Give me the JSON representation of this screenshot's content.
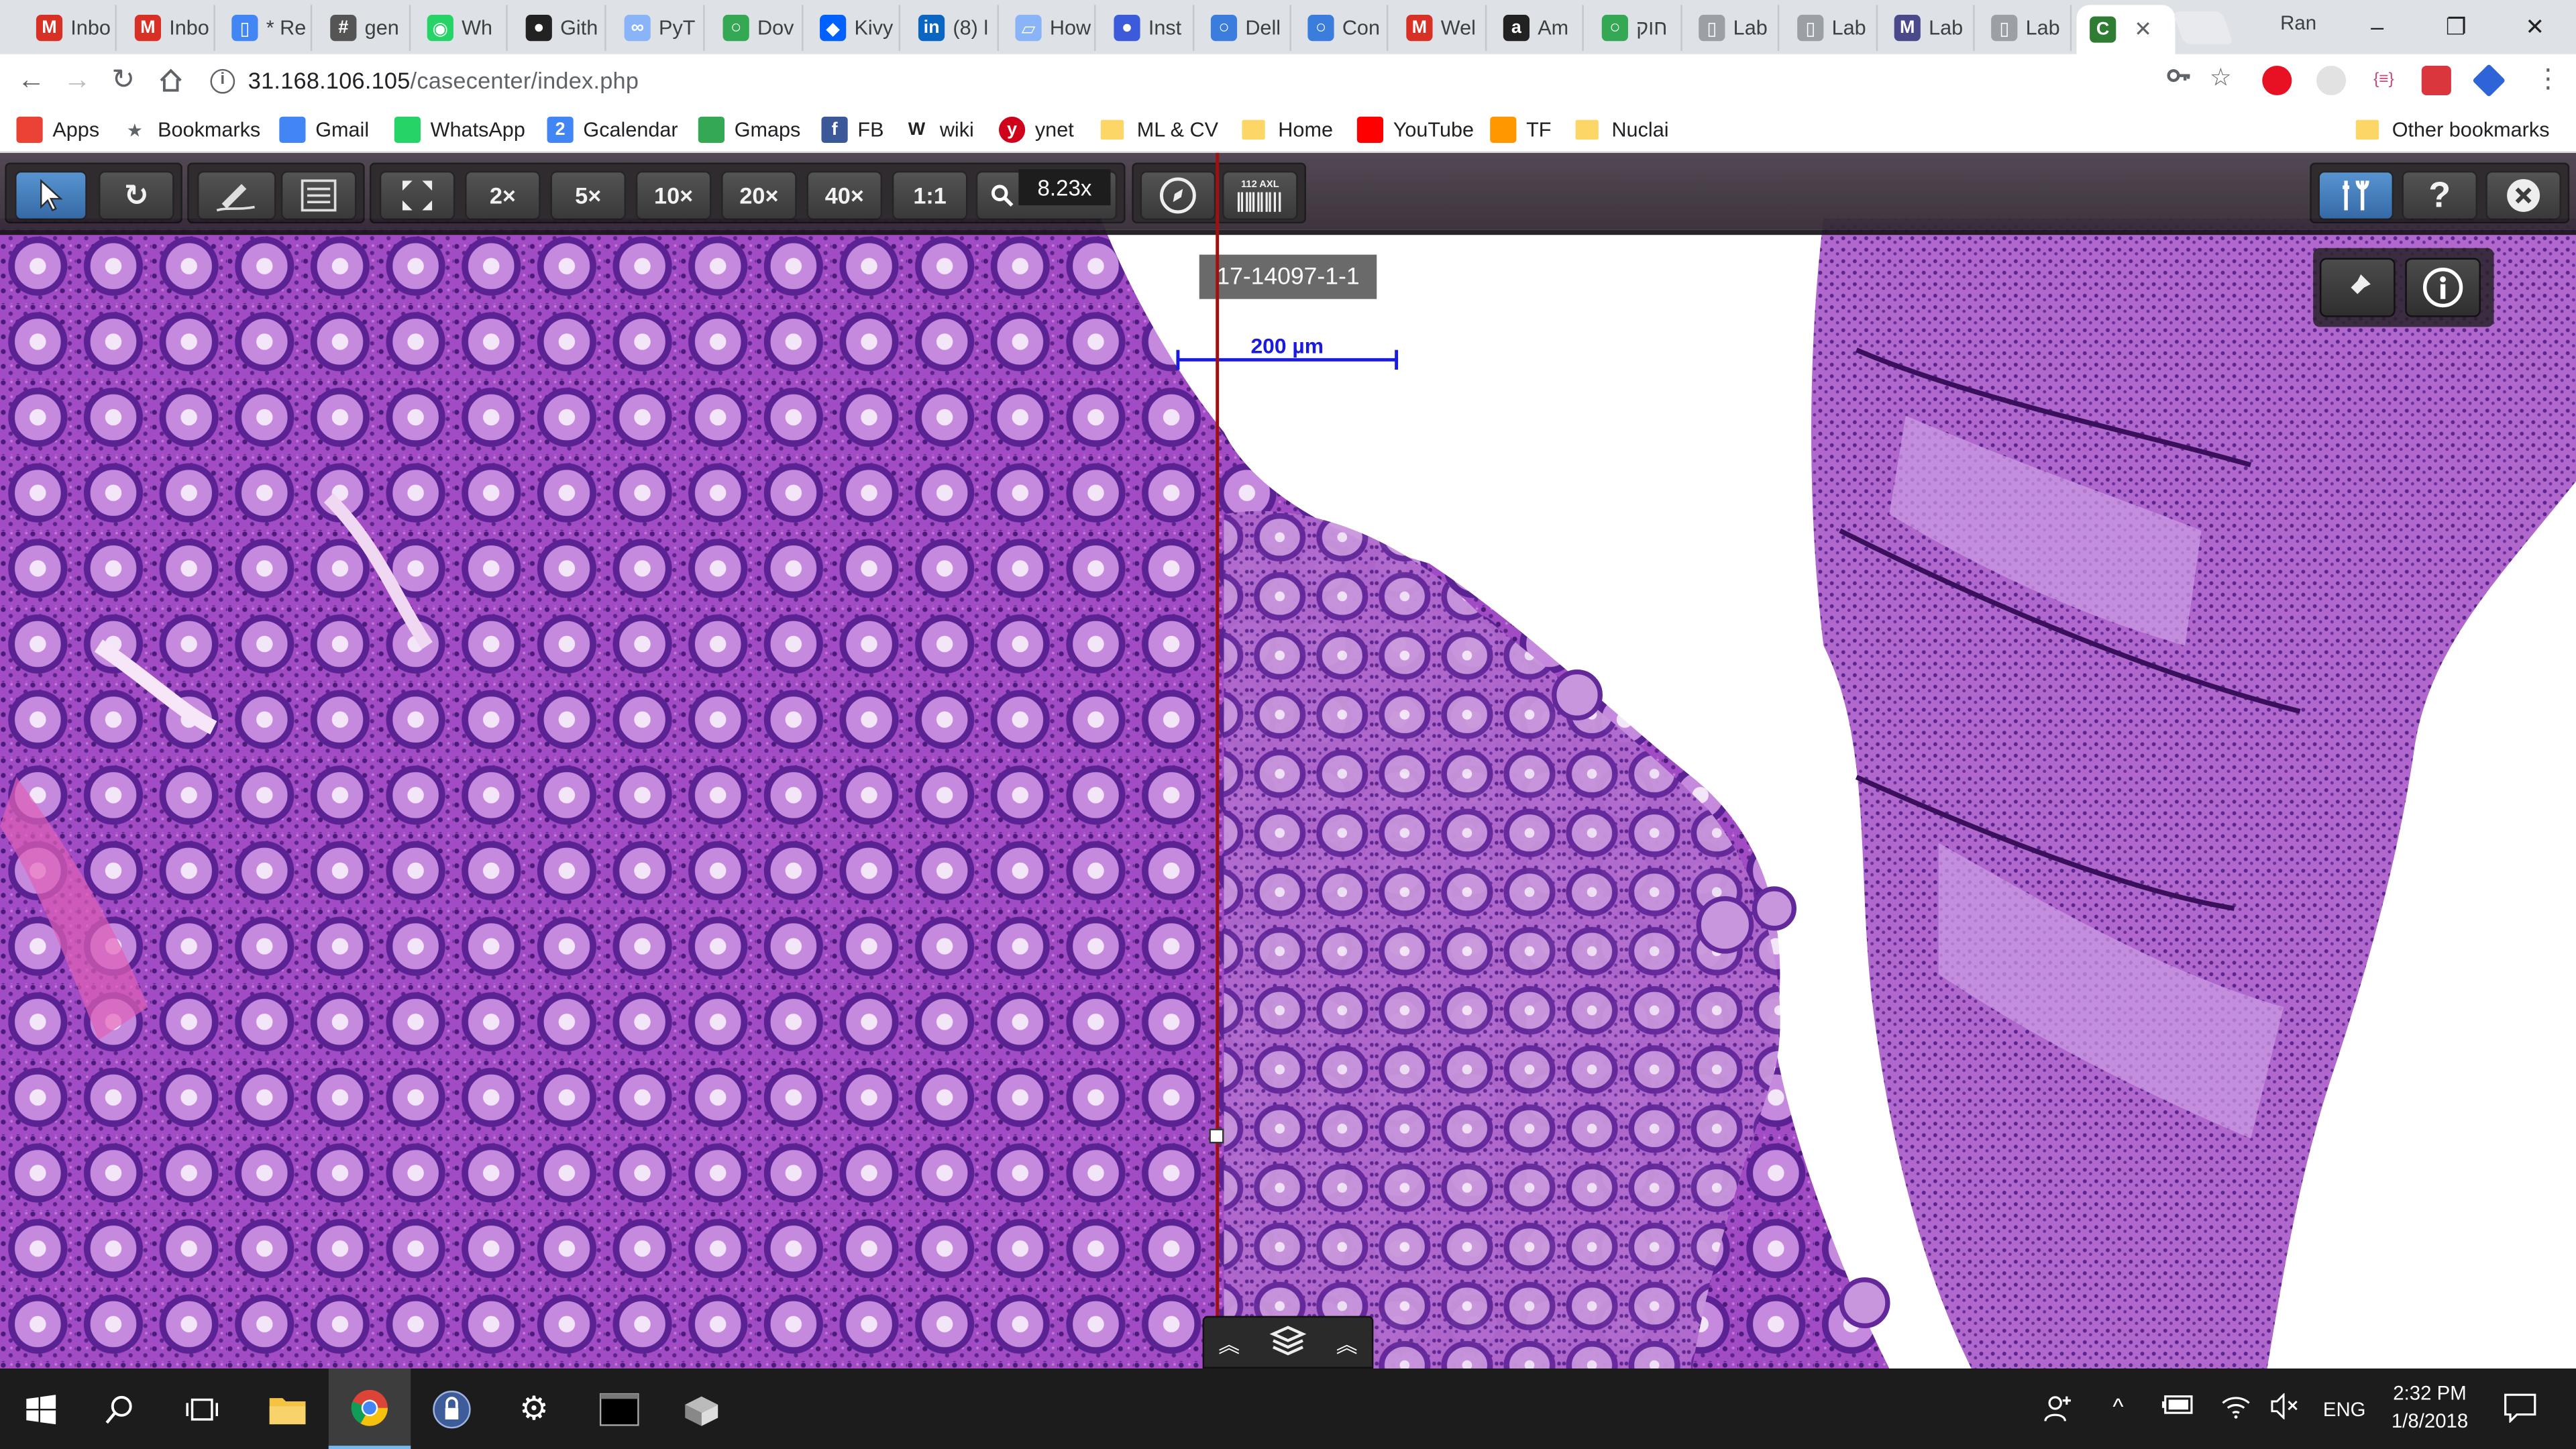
{
  "tabs": [
    {
      "label": "Inbo",
      "icon": "gmail-icon",
      "color": "#d93025",
      "glyph": "M"
    },
    {
      "label": "Inbo",
      "icon": "gmail-icon",
      "color": "#d93025",
      "glyph": "M"
    },
    {
      "label": "* Re",
      "icon": "document-icon",
      "color": "#4285f4",
      "glyph": "▯"
    },
    {
      "label": "gen",
      "icon": "hashtag-icon",
      "color": "#555555",
      "glyph": "#"
    },
    {
      "label": "Wh",
      "icon": "whatsapp-icon",
      "color": "#25d366",
      "glyph": "◉"
    },
    {
      "label": "Gith",
      "icon": "github-icon",
      "color": "#222222",
      "glyph": "●"
    },
    {
      "label": "PyT",
      "icon": "pytorch-icon",
      "color": "#8ab4f8",
      "glyph": "∞"
    },
    {
      "label": "Dov",
      "icon": "circle-icon",
      "color": "#34a853",
      "glyph": "○"
    },
    {
      "label": "Kivy",
      "icon": "dropbox-icon",
      "color": "#0061ff",
      "glyph": "◆"
    },
    {
      "label": "(8) l",
      "icon": "linkedin-icon",
      "color": "#0a66c2",
      "glyph": "in"
    },
    {
      "label": "How",
      "icon": "image-icon",
      "color": "#8ab4f8",
      "glyph": "▱"
    },
    {
      "label": "Inst",
      "icon": "dot-icon",
      "color": "#3b5bdb",
      "glyph": "●"
    },
    {
      "label": "Dell",
      "icon": "dell-icon",
      "color": "#3b7ddd",
      "glyph": "○"
    },
    {
      "label": "Con",
      "icon": "dell-icon",
      "color": "#3b7ddd",
      "glyph": "○"
    },
    {
      "label": "Wel",
      "icon": "gmail-icon",
      "color": "#d93025",
      "glyph": "M"
    },
    {
      "label": "Am",
      "icon": "amazon-icon",
      "color": "#222222",
      "glyph": "a"
    },
    {
      "label": "חוק",
      "icon": "circle-icon",
      "color": "#34a853",
      "glyph": "○"
    },
    {
      "label": "Lab",
      "icon": "page-icon",
      "color": "#9aa0a6",
      "glyph": "▯"
    },
    {
      "label": "Lab",
      "icon": "page-icon",
      "color": "#9aa0a6",
      "glyph": "▯"
    },
    {
      "label": "Lab",
      "icon": "lab-icon",
      "color": "#4a4a8a",
      "glyph": "M"
    },
    {
      "label": "Lab",
      "icon": "page-icon",
      "color": "#9aa0a6",
      "glyph": "▯"
    },
    {
      "label": "",
      "icon": "casecenter-icon",
      "color": "#2e7d32",
      "glyph": "C"
    }
  ],
  "profile_name": "Ran",
  "window": {
    "minimize": "–",
    "restore": "❐",
    "close": "✕"
  },
  "address_bar": {
    "host": "31.168.106.105",
    "path": "/casecenter/index.php"
  },
  "bookmarks": [
    {
      "label": "Apps",
      "icon": "apps-grid-icon"
    },
    {
      "label": "Bookmarks",
      "icon": "star-icon"
    },
    {
      "label": "Gmail",
      "icon": "mail-icon"
    },
    {
      "label": "WhatsApp",
      "icon": "whatsapp-icon"
    },
    {
      "label": "Gcalendar",
      "icon": "calendar-icon",
      "glyph": "2"
    },
    {
      "label": "Gmaps",
      "icon": "map-icon"
    },
    {
      "label": "FB",
      "icon": "facebook-icon",
      "glyph": "f"
    },
    {
      "label": "wiki",
      "icon": "wikipedia-icon",
      "glyph": "W"
    },
    {
      "label": "ynet",
      "icon": "ynet-icon",
      "glyph": "y"
    },
    {
      "label": "ML & CV",
      "icon": "folder-icon"
    },
    {
      "label": "Home",
      "icon": "folder-icon"
    },
    {
      "label": "YouTube",
      "icon": "youtube-icon"
    },
    {
      "label": "TF",
      "icon": "tensorflow-icon"
    },
    {
      "label": "Nuclai",
      "icon": "folder-icon"
    }
  ],
  "other_bookmarks": "Other bookmarks",
  "viewer": {
    "zoom_buttons": [
      "2×",
      "5×",
      "10×",
      "20×",
      "40×",
      "1:1"
    ],
    "zoom_value": "8.23x",
    "slide_label": "17-14097-1-1",
    "scale_label": "200 µm",
    "barcode_text": "112 AXL"
  },
  "taskbar": {
    "language": "ENG",
    "time": "2:32 PM",
    "date": "1/8/2018"
  },
  "colors": {
    "tabstrip": "#dee1e6",
    "viewer_toolbar": "#3d343f",
    "selected_tool": "#3d7fc4",
    "measure_line": "#a01010",
    "scale_bar": "#1b1be0",
    "tissue": "#a050c8",
    "taskbar": "#1c1c1c"
  }
}
